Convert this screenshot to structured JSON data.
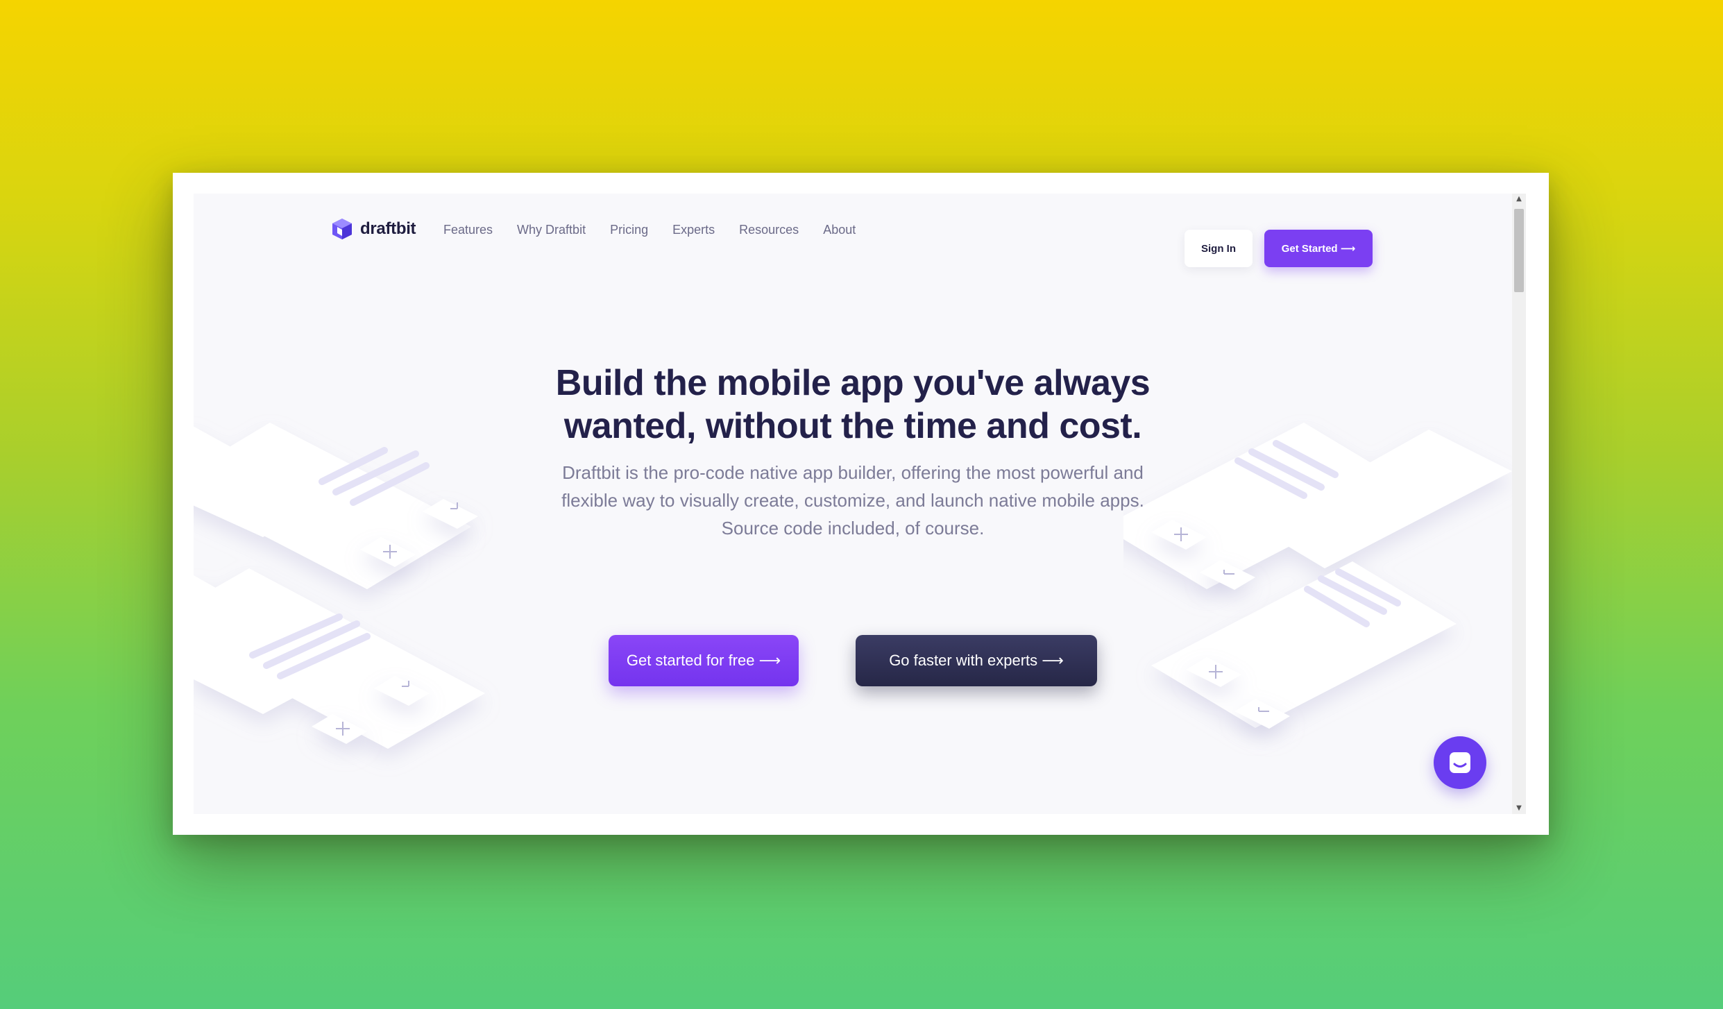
{
  "brand": {
    "name": "draftbit",
    "icon": "cube-logo-icon",
    "accent": "#7b3ff2",
    "dark": "#23214a"
  },
  "nav": {
    "links": [
      "Features",
      "Why Draftbit",
      "Pricing",
      "Experts",
      "Resources",
      "About"
    ],
    "sign_in": "Sign In",
    "get_started": "Get Started ⟶"
  },
  "hero": {
    "title": "Build the mobile app you've always wanted, without the time and cost.",
    "subtitle": "Draftbit is the pro-code native app builder, offering the most powerful and flexible way to visually create, customize, and launch native mobile apps. Source code included, of course.",
    "cta_primary": "Get started for free ⟶",
    "cta_secondary": "Go faster with experts ⟶"
  },
  "chat": {
    "icon": "chat-icon"
  },
  "scrollbar": {
    "up_icon": "scroll-up-arrow-icon",
    "down_icon": "scroll-down-arrow-icon"
  }
}
